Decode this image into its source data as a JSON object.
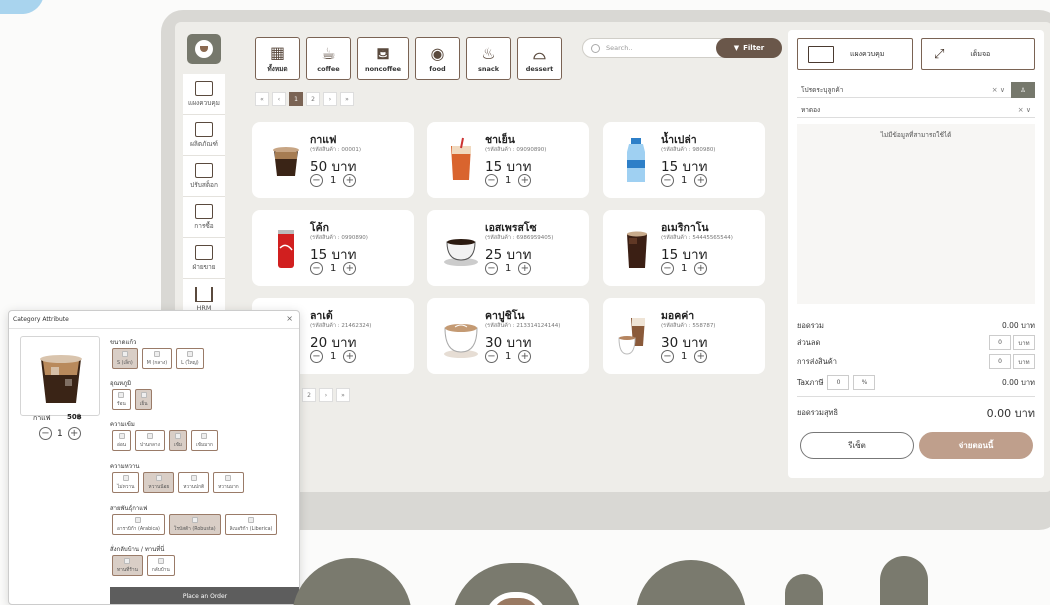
{
  "nav": {
    "items": [
      {
        "label": "แผงควบคุม",
        "icon": "dashboard-icon"
      },
      {
        "label": "ผลิตภัณฑ์",
        "icon": "product-box-icon"
      },
      {
        "label": "ปรับสต็อก",
        "icon": "stock-icon"
      },
      {
        "label": "การซื้อ",
        "icon": "purchase-icon"
      },
      {
        "label": "ฝ่ายขาย",
        "icon": "sales-icon"
      },
      {
        "label": "HRM",
        "icon": "bank-icon"
      }
    ]
  },
  "categories": [
    {
      "label": "ทั้งหมด",
      "icon": "grid-icon"
    },
    {
      "label": "coffee",
      "icon": "coffee-cup-icon"
    },
    {
      "label": "noncoffee",
      "icon": "cup-icon"
    },
    {
      "label": "food",
      "icon": "plate-icon"
    },
    {
      "label": "snack",
      "icon": "snack-icon"
    },
    {
      "label": "dessert",
      "icon": "dessert-icon"
    }
  ],
  "search": {
    "placeholder": "Search..",
    "filter_label": "Filter"
  },
  "pager": {
    "pages": [
      "«",
      "‹",
      "1",
      "2",
      "›",
      "»"
    ],
    "current": "1"
  },
  "pager2": {
    "pages": [
      "2",
      "›",
      "»"
    ]
  },
  "products": [
    {
      "name": "กาแฟ",
      "sku": "(รหัสสินค้า : 00001)",
      "price": "50 บาท",
      "qty": "1",
      "kind": "coffee"
    },
    {
      "name": "ชาเย็น",
      "sku": "(รหัสสินค้า : 09090890)",
      "price": "15 บาท",
      "qty": "1",
      "kind": "thaitea"
    },
    {
      "name": "น้ำเปล่า",
      "sku": "(รหัสสินค้า : 980980)",
      "price": "15 บาท",
      "qty": "1",
      "kind": "water"
    },
    {
      "name": "โค้ก",
      "sku": "(รหัสสินค้า : 0990890)",
      "price": "15 บาท",
      "qty": "1",
      "kind": "coke"
    },
    {
      "name": "เอสเพรสโซ",
      "sku": "(รหัสสินค้า : 6986959405)",
      "price": "25 บาท",
      "qty": "1",
      "kind": "espresso"
    },
    {
      "name": "อเมริกาโน",
      "sku": "(รหัสสินค้า : 54445565544)",
      "price": "15 บาท",
      "qty": "1",
      "kind": "americano"
    },
    {
      "name": "ลาเต้",
      "sku": "(รหัสสินค้า : 21462324)",
      "price": "20 บาท",
      "qty": "1",
      "kind": "latte"
    },
    {
      "name": "คาปูชิโน",
      "sku": "(รหัสสินค้า : 213314124144)",
      "price": "30 บาท",
      "qty": "1",
      "kind": "cappuccino"
    },
    {
      "name": "มอคค่า",
      "sku": "(รหัสสินค้า : 558787)",
      "price": "30 บาท",
      "qty": "1",
      "kind": "mocha"
    }
  ],
  "right": {
    "dashboard_label": "แผงควบคุม",
    "fullscreen_label": "เต็มจอ",
    "customer_placeholder": "โปรดระบุลูกค้า",
    "table_label": "หาดอง",
    "empty_text": "ไม่มีข้อมูลที่สามารถใช้ได้",
    "total_label": "ยอดรวม",
    "total_value": "0.00 บาท",
    "discount_label": "ส่วนลด",
    "discount_value": "0",
    "discount_unit": "บาท",
    "shipping_label": "การส่งสินค้า",
    "shipping_value": "0",
    "shipping_unit": "บาท",
    "tax_label": "Taxภาษี",
    "tax_value": "0",
    "tax_unit": "%",
    "tax_total": "0.00 บาท",
    "net_label": "ยอดรวมสุทธิ",
    "net_value": "0.00 บาท",
    "reset_label": "รีเซ็ต",
    "pay_label": "จ่ายตอนนี้"
  },
  "modal": {
    "title": "Category Attribute",
    "close": "×",
    "product_name": "กาแฟ",
    "product_price": "50฿",
    "qty": "1",
    "groups": [
      {
        "label": "ขนาดแก้ว",
        "options": [
          {
            "t": "S (เล็ก)",
            "sel": true
          },
          {
            "t": "M (กลาง)",
            "sel": false
          },
          {
            "t": "L (ใหญ่)",
            "sel": false
          }
        ]
      },
      {
        "label": "อุณหภูมิ",
        "options": [
          {
            "t": "ร้อน",
            "sel": false
          },
          {
            "t": "เย็น",
            "sel": true
          }
        ]
      },
      {
        "label": "ความเข้ม",
        "options": [
          {
            "t": "อ่อน",
            "sel": false
          },
          {
            "t": "ปานกลาง",
            "sel": false
          },
          {
            "t": "เข้ม",
            "sel": true
          },
          {
            "t": "เข้มมาก",
            "sel": false
          }
        ]
      },
      {
        "label": "ความหวาน",
        "options": [
          {
            "t": "ไม่หวาน",
            "sel": false
          },
          {
            "t": "หวานน้อย",
            "sel": true
          },
          {
            "t": "หวานปกติ",
            "sel": false
          },
          {
            "t": "หวานมาก",
            "sel": false
          }
        ]
      },
      {
        "label": "สายพันธุ์กาแฟ",
        "options": [
          {
            "t": "อาราบิก้า (Arabica)",
            "sel": false
          },
          {
            "t": "โรบัสต้า (Robusta)",
            "sel": true
          },
          {
            "t": "ลิเบอริก้า (Liberica)",
            "sel": false
          }
        ]
      },
      {
        "label": "สั่งกลับบ้าน / ทานที่นี่",
        "options": [
          {
            "t": "ทานที่ร้าน",
            "sel": true
          },
          {
            "t": "กลับบ้าน",
            "sel": false
          }
        ]
      }
    ],
    "order_label": "Place an Order"
  }
}
